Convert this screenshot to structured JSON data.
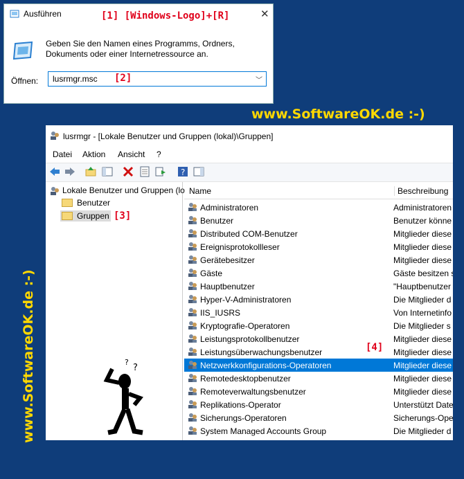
{
  "run_dialog": {
    "title": "Ausführen",
    "annotation_1": "[1]  [Windows-Logo]+[R]",
    "description": "Geben Sie den Namen eines Programms, Ordners, Dokuments oder einer Internetressource an.",
    "open_label": "Öffnen:",
    "input_value": "lusrmgr.msc",
    "annotation_2": "[2]"
  },
  "watermark": {
    "top": "www.SoftwareOK.de :-)",
    "side": "www.SoftwareOK.de :-)"
  },
  "mmc": {
    "title": "lusrmgr - [Lokale Benutzer und Gruppen (lokal)\\Gruppen]",
    "menu": [
      "Datei",
      "Aktion",
      "Ansicht",
      "?"
    ],
    "tree_root": "Lokale Benutzer und Gruppen (lo",
    "tree_items": [
      "Benutzer",
      "Gruppen"
    ],
    "annotation_3": "[3]",
    "annotation_4": "[4]",
    "columns": [
      "Name",
      "Beschreibung"
    ],
    "rows": [
      {
        "name": "Administratoren",
        "desc": "Administratoren"
      },
      {
        "name": "Benutzer",
        "desc": "Benutzer könne"
      },
      {
        "name": "Distributed COM-Benutzer",
        "desc": "Mitglieder diese"
      },
      {
        "name": "Ereignisprotokollleser",
        "desc": "Mitglieder diese"
      },
      {
        "name": "Gerätebesitzer",
        "desc": "Mitglieder diese"
      },
      {
        "name": "Gäste",
        "desc": "Gäste besitzen s"
      },
      {
        "name": "Hauptbenutzer",
        "desc": "\"Hauptbenutzer"
      },
      {
        "name": "Hyper-V-Administratoren",
        "desc": "Die Mitglieder d"
      },
      {
        "name": "IIS_IUSRS",
        "desc": "Von Internetinfo"
      },
      {
        "name": "Kryptografie-Operatoren",
        "desc": "Die Mitglieder s"
      },
      {
        "name": "Leistungsprotokollbenutzer",
        "desc": "Mitglieder diese"
      },
      {
        "name": "Leistungsüberwachungsbenutzer",
        "desc": "Mitglieder diese"
      },
      {
        "name": "Netzwerkkonfigurations-Operatoren",
        "desc": "Mitglieder diese"
      },
      {
        "name": "Remotedesktopbenutzer",
        "desc": "Mitglieder diese"
      },
      {
        "name": "Remoteverwaltungsbenutzer",
        "desc": "Mitglieder diese"
      },
      {
        "name": "Replikations-Operator",
        "desc": "Unterstützt Date"
      },
      {
        "name": "Sicherungs-Operatoren",
        "desc": "Sicherungs-Ope"
      },
      {
        "name": "System Managed Accounts Group",
        "desc": "Die Mitglieder d"
      }
    ],
    "selected_row": "Netzwerkkonfigurations-Operatoren"
  },
  "colors": {
    "background": "#0f3d7a",
    "watermark": "#ffd800",
    "annotation": "#e0001a",
    "selection": "#0078d7"
  }
}
